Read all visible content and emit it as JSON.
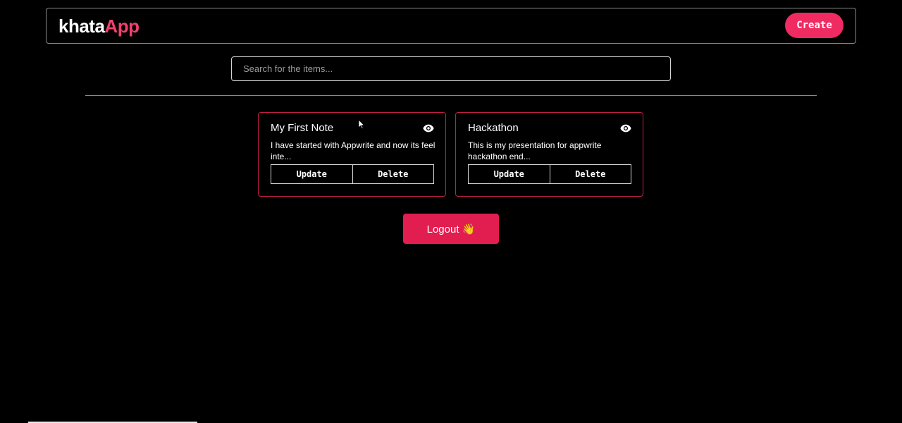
{
  "navbar": {
    "logo_part1": "khata",
    "logo_part2": "App",
    "create_label": "Create"
  },
  "search": {
    "placeholder": "Search for the items...",
    "value": ""
  },
  "notes": [
    {
      "title": "My First Note",
      "body": "I have started with Appwrite and now its feel inte...",
      "update_label": "Update",
      "delete_label": "Delete",
      "icon": "eye-icon"
    },
    {
      "title": "Hackathon",
      "body": "This is my presentation for appwrite hackathon end...",
      "update_label": "Update",
      "delete_label": "Delete",
      "icon": "eye-icon"
    }
  ],
  "logout_label": "Logout 👋",
  "colors": {
    "background": "#000000",
    "accent": "#ef2b62",
    "card_border": "#c21f47",
    "logout": "#e21d4f"
  }
}
